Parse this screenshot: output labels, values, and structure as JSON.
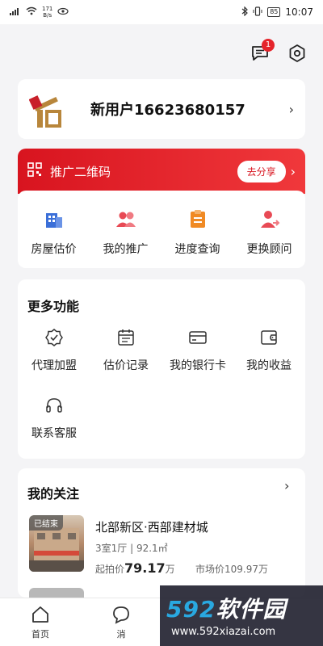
{
  "status": {
    "speed_top": "171",
    "speed_unit": "B/s",
    "battery": "85",
    "time": "10:07"
  },
  "header": {
    "message_badge": "1"
  },
  "user": {
    "name": "新用户16623680157"
  },
  "promo": {
    "label": "推广二维码",
    "share_button": "去分享"
  },
  "quick_actions": [
    {
      "label": "房屋估价",
      "icon": "building-icon"
    },
    {
      "label": "我的推广",
      "icon": "people-icon"
    },
    {
      "label": "进度查询",
      "icon": "clipboard-icon"
    },
    {
      "label": "更换顾问",
      "icon": "user-swap-icon"
    }
  ],
  "more": {
    "title": "更多功能",
    "items": [
      {
        "label": "代理加盟",
        "icon": "badge-check-icon"
      },
      {
        "label": "估价记录",
        "icon": "calendar-list-icon"
      },
      {
        "label": "我的银行卡",
        "icon": "bank-card-icon"
      },
      {
        "label": "我的收益",
        "icon": "wallet-icon"
      },
      {
        "label": "联系客服",
        "icon": "headset-icon"
      }
    ]
  },
  "follow": {
    "title": "我的关注",
    "item": {
      "tag": "已结束",
      "title": "北部新区·西部建材城",
      "spec": "3室1厅 | 92.1㎡",
      "start_label": "起拍价",
      "start_value": "79.17",
      "start_unit": "万",
      "market": "市场价109.97万"
    }
  },
  "tabbar": {
    "home": "首页",
    "messages": "消"
  },
  "watermark": {
    "brand_num": "592",
    "brand_text": "软件园",
    "url": "www.592xiazai.com"
  },
  "colors": {
    "brand_red": "#d8141f",
    "accent_blue": "#3b6fd8",
    "accent_orange": "#f08a24"
  }
}
